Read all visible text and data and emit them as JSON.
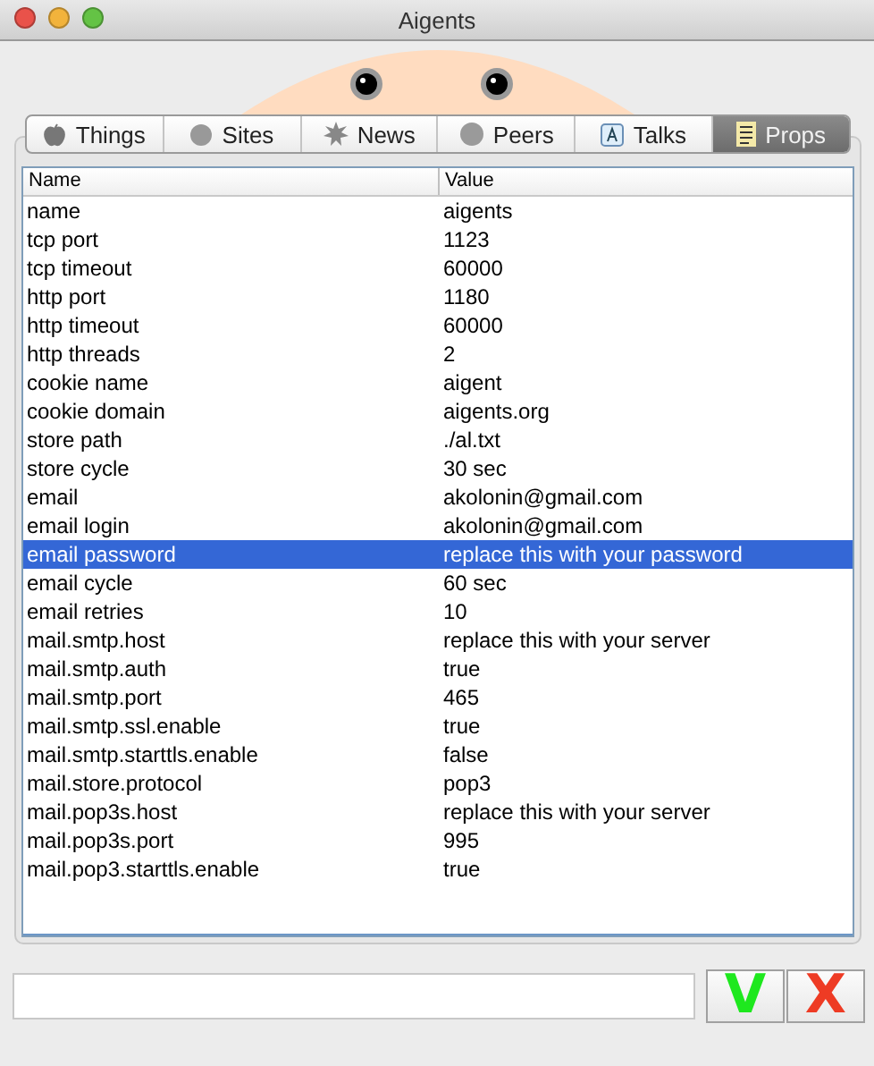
{
  "window": {
    "title": "Aigents"
  },
  "tabs": [
    {
      "label": "Things",
      "kind": "apple",
      "selected": false
    },
    {
      "label": "Sites",
      "kind": "web",
      "selected": false
    },
    {
      "label": "News",
      "kind": "burst",
      "selected": false
    },
    {
      "label": "Peers",
      "kind": "face",
      "selected": false
    },
    {
      "label": "Talks",
      "kind": "chat",
      "selected": false
    },
    {
      "label": "Props",
      "kind": "sheet",
      "selected": true
    }
  ],
  "table": {
    "columns": [
      "Name",
      "Value"
    ],
    "rows": [
      {
        "name": "name",
        "value": "aigents",
        "selected": false
      },
      {
        "name": "tcp port",
        "value": "1123",
        "selected": false
      },
      {
        "name": "tcp timeout",
        "value": "60000",
        "selected": false
      },
      {
        "name": "http port",
        "value": "1180",
        "selected": false
      },
      {
        "name": "http timeout",
        "value": "60000",
        "selected": false
      },
      {
        "name": "http threads",
        "value": "2",
        "selected": false
      },
      {
        "name": "cookie name",
        "value": "aigent",
        "selected": false
      },
      {
        "name": "cookie domain",
        "value": "aigents.org",
        "selected": false
      },
      {
        "name": "store path",
        "value": "./al.txt",
        "selected": false
      },
      {
        "name": "store cycle",
        "value": "30 sec",
        "selected": false
      },
      {
        "name": "email",
        "value": "akolonin@gmail.com",
        "selected": false
      },
      {
        "name": "email login",
        "value": "akolonin@gmail.com",
        "selected": false
      },
      {
        "name": "email password",
        "value": "replace this with your password",
        "selected": true
      },
      {
        "name": "email cycle",
        "value": "60 sec",
        "selected": false
      },
      {
        "name": "email retries",
        "value": "10",
        "selected": false
      },
      {
        "name": "mail.smtp.host",
        "value": "replace this with your server",
        "selected": false
      },
      {
        "name": "mail.smtp.auth",
        "value": "true",
        "selected": false
      },
      {
        "name": "mail.smtp.port",
        "value": "465",
        "selected": false
      },
      {
        "name": "mail.smtp.ssl.enable",
        "value": "true",
        "selected": false
      },
      {
        "name": "mail.smtp.starttls.enable",
        "value": "false",
        "selected": false
      },
      {
        "name": "mail.store.protocol",
        "value": "pop3",
        "selected": false
      },
      {
        "name": "mail.pop3s.host",
        "value": "replace this with your server",
        "selected": false
      },
      {
        "name": "mail.pop3s.port",
        "value": "995",
        "selected": false
      },
      {
        "name": "mail.pop3.starttls.enable",
        "value": "true",
        "selected": false
      }
    ]
  },
  "buttons": [
    {
      "label": "V",
      "kind": "ok"
    },
    {
      "label": "X",
      "kind": "cancel"
    }
  ]
}
